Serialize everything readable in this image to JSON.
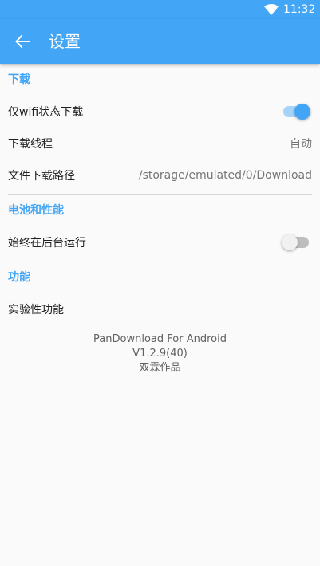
{
  "status_bar": {
    "time": "11:32",
    "icons": [
      "wifi-icon"
    ]
  },
  "app_bar": {
    "title": "设置",
    "back_icon": "back-arrow-icon"
  },
  "sections": {
    "download": {
      "title": "下载",
      "wifi_only": {
        "label": "仅wifi状态下载",
        "enabled": true
      },
      "threads": {
        "label": "下载线程",
        "value": "自动"
      },
      "path": {
        "label": "文件下载路径",
        "value": "/storage/emulated/0/Download"
      }
    },
    "battery": {
      "title": "电池和性能",
      "background": {
        "label": "始终在后台运行",
        "enabled": false
      }
    },
    "features": {
      "title": "功能",
      "experimental": {
        "label": "实验性功能"
      }
    }
  },
  "footer": {
    "app_name": "PanDownload For Android",
    "version": "V1.2.9(40)",
    "author": "双霖作品"
  },
  "colors": {
    "accent": "#42a5f5",
    "background": "#fafafa",
    "divider": "#d6d6d6"
  }
}
